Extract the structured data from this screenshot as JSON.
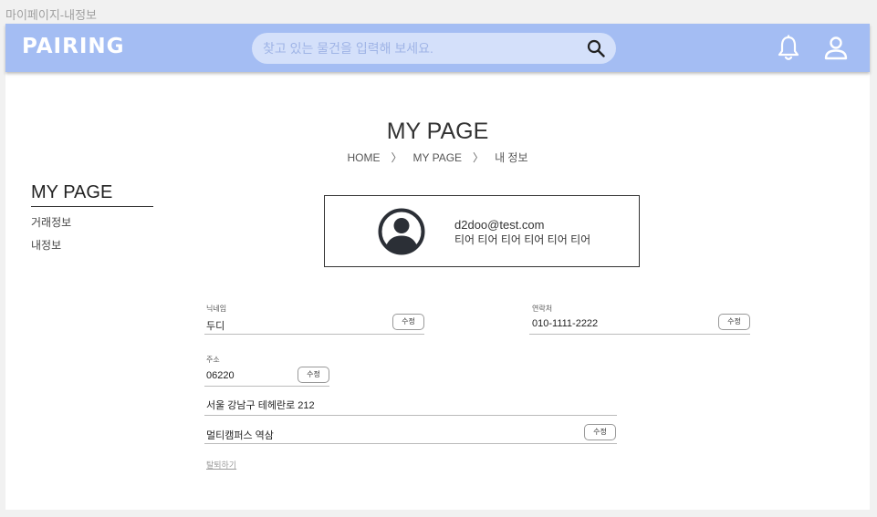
{
  "frame": {
    "title": "마이페이지-내정보"
  },
  "header": {
    "logo": "PAIRING",
    "search_placeholder": "찾고 있는 물건을 입력해 보세요.",
    "icons": [
      "search-icon",
      "bell-icon",
      "user-icon"
    ]
  },
  "page": {
    "title": "MY PAGE",
    "breadcrumb": [
      "HOME",
      "MY PAGE",
      "내 정보"
    ],
    "breadcrumb_sep": "〉"
  },
  "sidebar": {
    "title": "MY PAGE",
    "items": [
      "거래정보",
      "내정보"
    ]
  },
  "profile": {
    "email": "d2doo@test.com",
    "tier": "티어 티어 티어 티어 티어 티어"
  },
  "form": {
    "nickname": {
      "label": "닉네임",
      "value": "두디",
      "edit": "수정"
    },
    "phone": {
      "label": "연락처",
      "value": "010-1111-2222",
      "edit": "수정"
    },
    "address": {
      "label": "주소",
      "zipcode": "06220",
      "line1": "서울 강남구 테헤란로 212",
      "line2": "멀티캠퍼스 역삼",
      "zip_edit": "수정",
      "detail_edit": "수정"
    },
    "withdraw": "탈퇴하기"
  },
  "colors": {
    "header": "#a4bdf3",
    "search_bg": "#d4e0fa",
    "text": "#222222"
  }
}
